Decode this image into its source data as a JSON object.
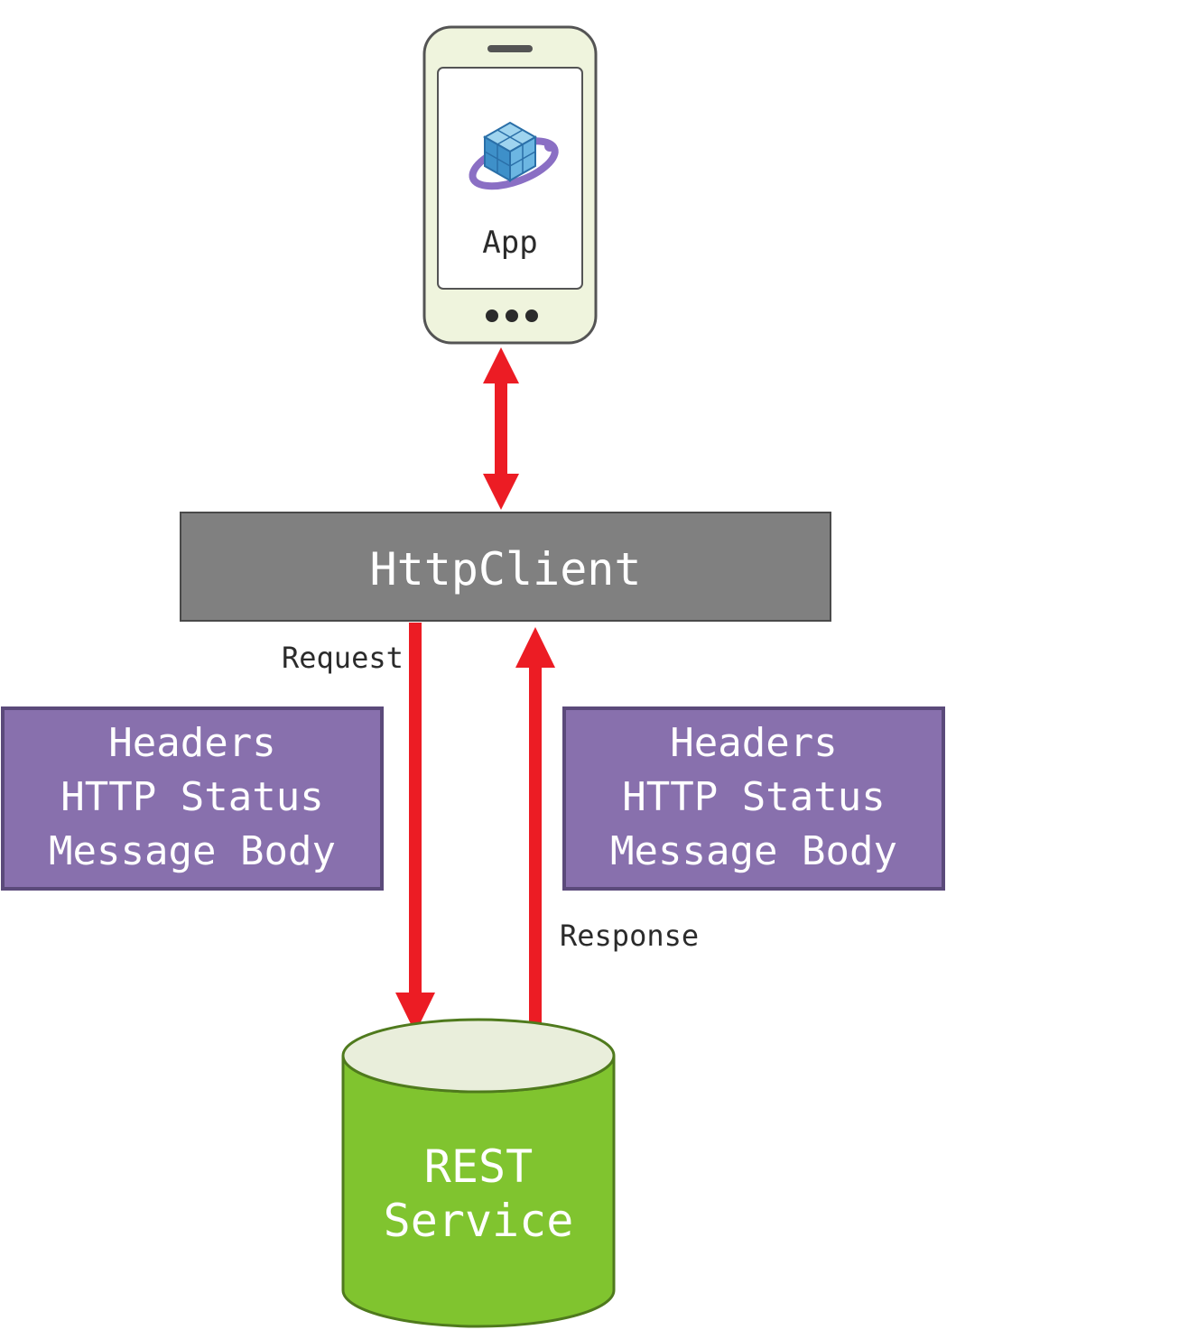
{
  "phone": {
    "app_label": "App"
  },
  "httpclient": {
    "label": "HttpClient"
  },
  "request": {
    "label": "Request",
    "box": {
      "line1": "Headers",
      "line2": "HTTP Status",
      "line3": "Message Body"
    }
  },
  "response": {
    "label": "Response",
    "box": {
      "line1": "Headers",
      "line2": "HTTP Status",
      "line3": "Message Body"
    }
  },
  "rest": {
    "line1": "REST",
    "line2": "Service"
  },
  "colors": {
    "arrow": "#ec1c24",
    "httpclient_fill": "#808080",
    "msg_fill": "#8870ad",
    "msg_stroke": "#5b4a7a",
    "rest_fill": "#80c42f",
    "rest_top": "#e9eedb",
    "rest_stroke": "#4f7a1d",
    "phone_body": "#eff4dd",
    "phone_stroke": "#545454"
  }
}
